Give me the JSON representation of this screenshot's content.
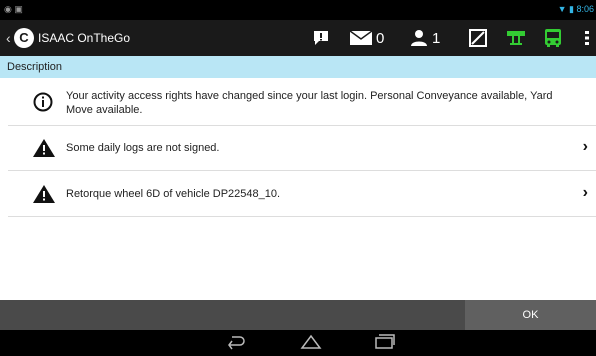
{
  "status_bar": {
    "time": "8:06"
  },
  "app_bar": {
    "title": "ISAAC OnTheGo",
    "messages_count": "0",
    "users_count": "1"
  },
  "section_header": "Description",
  "items": [
    {
      "icon": "info-icon",
      "text": "Your activity access rights have changed since your last login. Personal Conveyance available, Yard Move available."
    },
    {
      "icon": "warning-icon",
      "text": "Some daily logs are not signed."
    },
    {
      "icon": "warning-icon",
      "text": "Retorque wheel 6D of vehicle DP22548_10."
    }
  ],
  "footer": {
    "ok_label": "OK"
  },
  "colors": {
    "accent_green": "#33cc33",
    "header_blue": "#b9e6f5",
    "status_blue": "#33b5e5"
  }
}
